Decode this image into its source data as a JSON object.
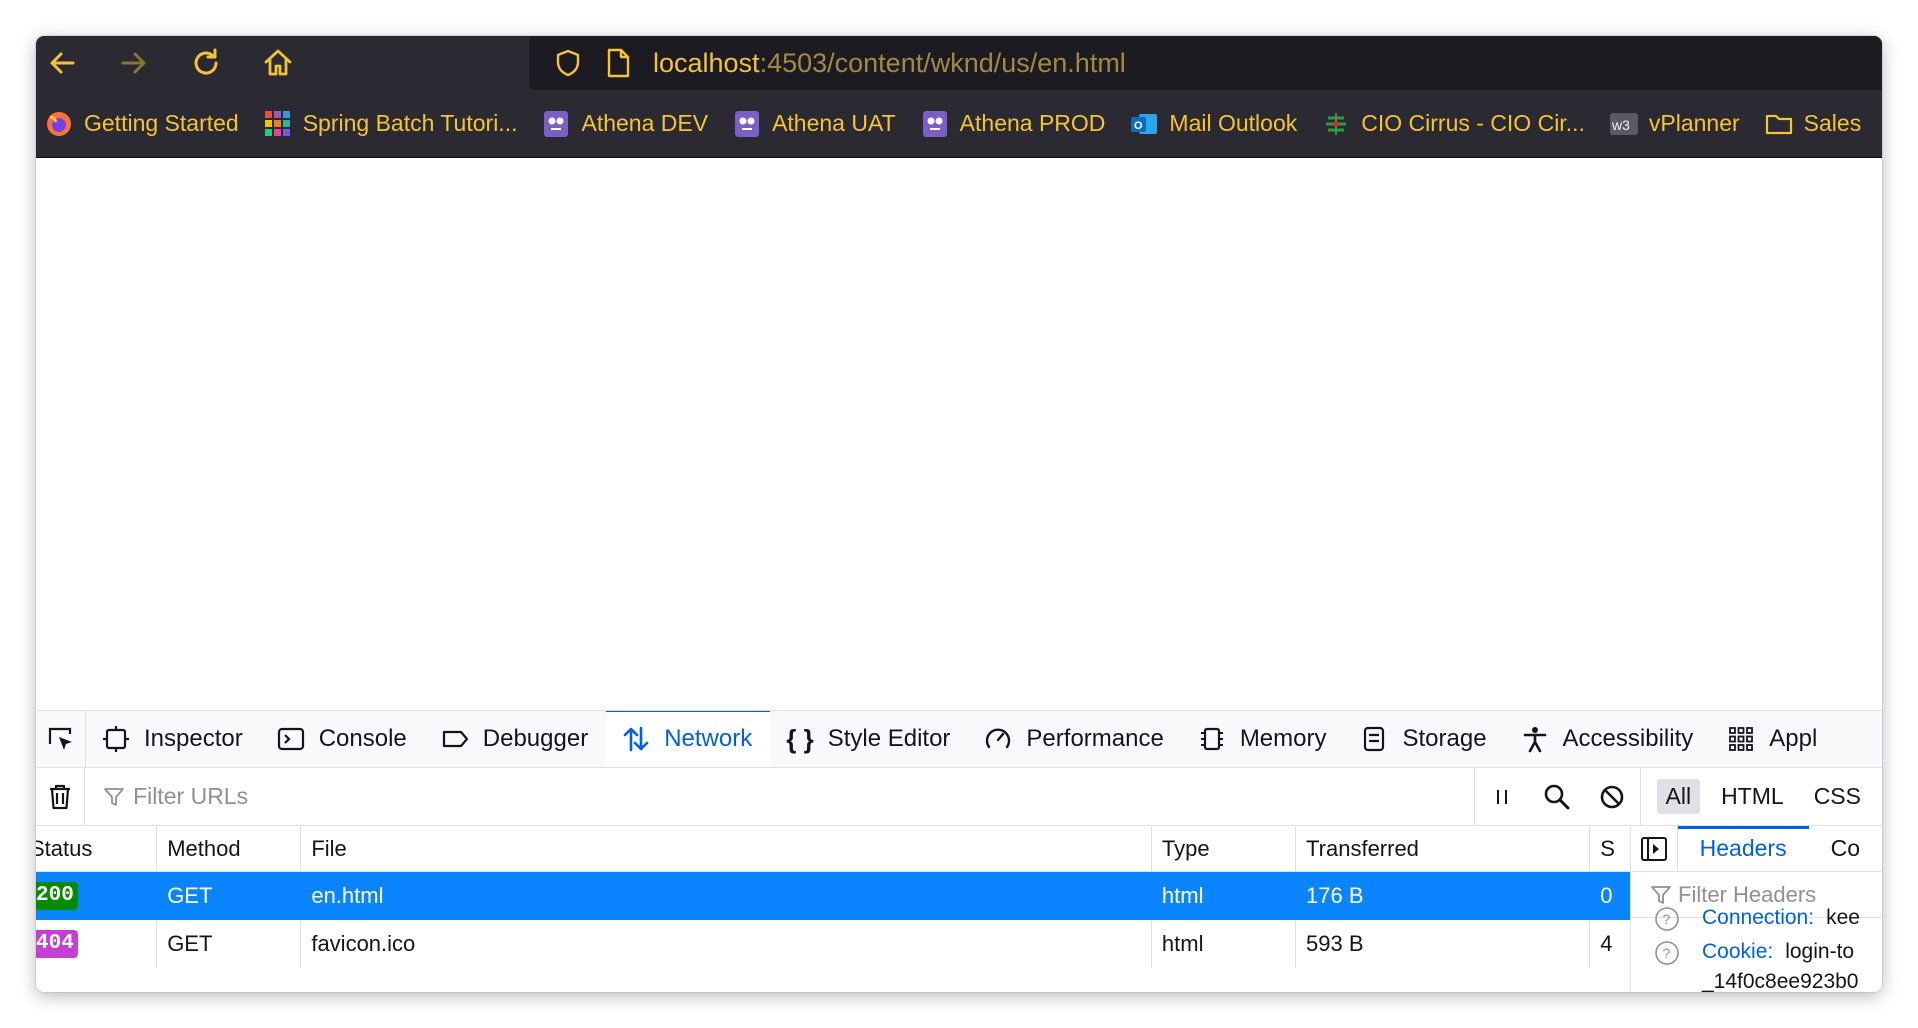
{
  "toolbar": {
    "back_icon": "back-arrow-icon",
    "forward_icon": "forward-arrow-icon",
    "reload_icon": "reload-icon",
    "home_icon": "home-icon",
    "url_host": "localhost",
    "url_rest": ":4503/content/wknd/us/en.html",
    "accent_color": "#f4c437"
  },
  "bookmarks": [
    {
      "label": "Getting Started",
      "icon": "firefox-icon"
    },
    {
      "label": "Spring Batch Tutori...",
      "icon": "grid-icon"
    },
    {
      "label": "Athena DEV",
      "icon": "owl-icon"
    },
    {
      "label": "Athena UAT",
      "icon": "owl-icon"
    },
    {
      "label": "Athena PROD",
      "icon": "owl-icon"
    },
    {
      "label": "Mail Outlook",
      "icon": "outlook-icon"
    },
    {
      "label": "CIO Cirrus - CIO Cir...",
      "icon": "cirrus-icon"
    },
    {
      "label": "vPlanner",
      "icon": "w3-icon"
    },
    {
      "label": "Sales",
      "icon": "folder-icon"
    }
  ],
  "devtools": {
    "tabs": [
      {
        "label": "Inspector",
        "icon": "inspector-icon"
      },
      {
        "label": "Console",
        "icon": "console-icon"
      },
      {
        "label": "Debugger",
        "icon": "debugger-icon"
      },
      {
        "label": "Network",
        "icon": "network-icon",
        "active": true
      },
      {
        "label": "Style Editor",
        "icon": "style-editor-icon"
      },
      {
        "label": "Performance",
        "icon": "performance-icon"
      },
      {
        "label": "Memory",
        "icon": "memory-icon"
      },
      {
        "label": "Storage",
        "icon": "storage-icon"
      },
      {
        "label": "Accessibility",
        "icon": "accessibility-icon"
      },
      {
        "label": "Appl",
        "icon": "application-icon"
      }
    ],
    "filter_placeholder": "Filter URLs",
    "type_filters": [
      "All",
      "HTML",
      "CSS"
    ],
    "columns": {
      "status": "Status",
      "method": "Method",
      "file": "File",
      "type": "Type",
      "transferred": "Transferred",
      "size": "S"
    },
    "requests": [
      {
        "status": "200",
        "status_color": "#058b00",
        "method": "GET",
        "file": "en.html",
        "type": "html",
        "transferred": "176 B",
        "size": "0",
        "selected": true
      },
      {
        "status": "404",
        "status_color": "#c53fd6",
        "method": "GET",
        "file": "favicon.ico",
        "type": "html",
        "transferred": "593 B",
        "size": "4",
        "selected": false
      }
    ],
    "side_panel": {
      "tab_headers": "Headers",
      "tab_cookies": "Co",
      "filter_placeholder": "Filter Headers",
      "headers": [
        {
          "name": "Connection:",
          "value": "kee"
        },
        {
          "name": "Cookie:",
          "value": "login-to",
          "continuation": "_14f0c8ee923b0"
        }
      ]
    }
  }
}
